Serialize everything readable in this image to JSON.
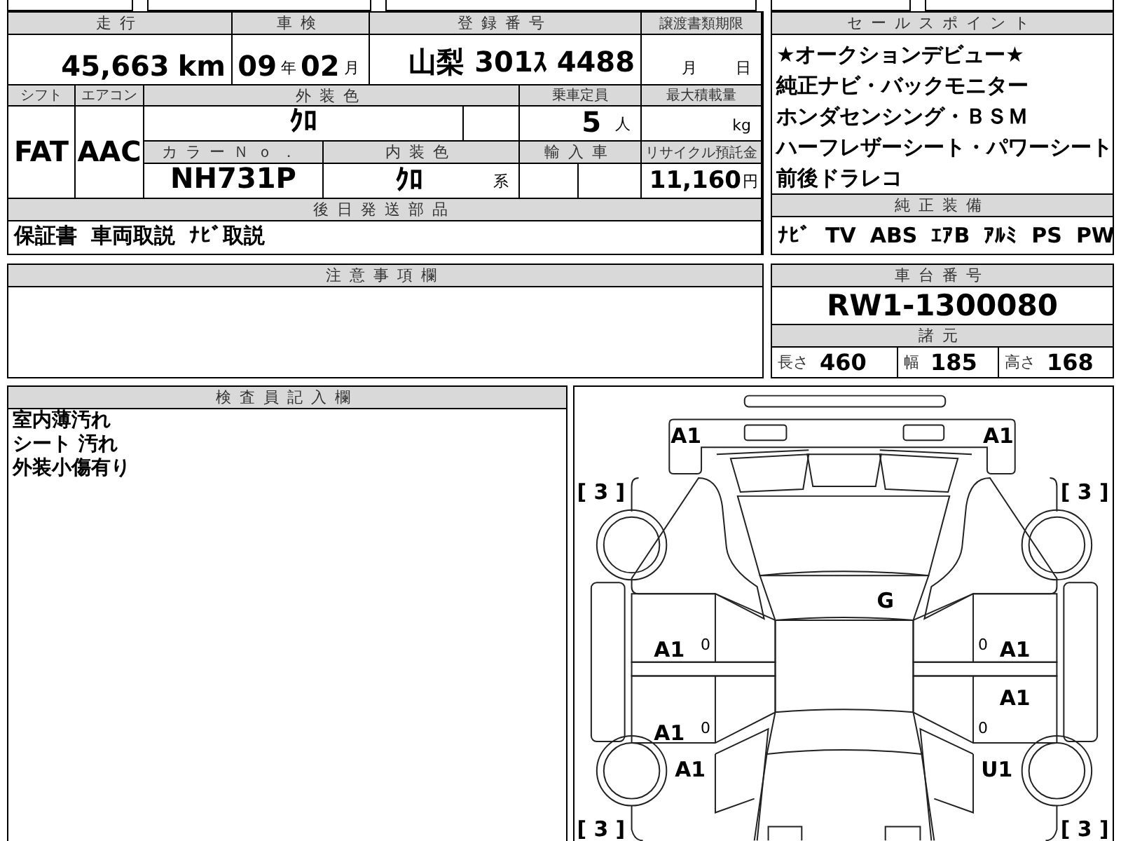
{
  "top_fields": {
    "mileage": {
      "label": "走行",
      "value": "45,663",
      "unit": "km"
    },
    "inspection": {
      "label": "車検",
      "year": "09",
      "year_unit": "年",
      "month": "02",
      "month_unit": "月"
    },
    "registration": {
      "label": "登録番号",
      "value": "山梨 301ｽ 4488"
    },
    "transfer_deadline": {
      "label": "譲渡書類期限",
      "month_unit": "月",
      "day_unit": "日"
    }
  },
  "specs": {
    "shift": {
      "label": "シフト",
      "value": "FAT"
    },
    "aircon": {
      "label": "エアコン",
      "value": "AAC"
    },
    "exterior_color": {
      "label": "外装色",
      "value": "ｸﾛ"
    },
    "capacity": {
      "label": "乗車定員",
      "value": "5",
      "unit": "人"
    },
    "max_load": {
      "label": "最大積載量",
      "unit": "kg"
    },
    "color_no": {
      "label": "カラーＮｏ．",
      "value": "NH731P"
    },
    "interior_color": {
      "label": "内装色",
      "value": "ｸﾛ",
      "unit": "系"
    },
    "import": {
      "label": "輸入車"
    },
    "recycle": {
      "label": "リサイクル預託金",
      "value": "11,160",
      "unit": "円"
    }
  },
  "later_parts": {
    "label": "後日発送部品",
    "items": [
      "保証書",
      "車両取説",
      "ﾅﾋﾞ取説"
    ]
  },
  "sales_points": {
    "label": "セールスポイント",
    "lines": [
      "★オークションデビュー★",
      "純正ナビ・バックモニター",
      "ホンダセンシング・ＢＳＭ",
      "ハーフレザーシート・パワーシート",
      "前後ドラレコ"
    ]
  },
  "equipment": {
    "label": "純正装備",
    "items": [
      "ﾅﾋﾞ",
      "TV",
      "ABS",
      "ｴｱB",
      "ｱﾙﾐ",
      "PS",
      "PW"
    ]
  },
  "notes": {
    "label": "注意事項欄"
  },
  "chassis": {
    "label": "車台番号",
    "value": "RW1-1300080"
  },
  "dimensions": {
    "label": "諸元",
    "items": [
      {
        "label": "長さ",
        "value": "460"
      },
      {
        "label": "幅",
        "value": "185"
      },
      {
        "label": "高さ",
        "value": "168"
      }
    ]
  },
  "inspector": {
    "label": "検査員記入欄",
    "lines": [
      "室内薄汚れ",
      "シート 汚れ",
      "外装小傷有り"
    ]
  },
  "diagram": {
    "marks": [
      "A1",
      "A1",
      "G",
      "A1",
      "A1",
      "A1",
      "A1",
      "A1",
      "U1"
    ],
    "zeros": [
      "0",
      "0",
      "0",
      "0"
    ],
    "ratings": [
      "[ 3 ]",
      "[ 3 ]",
      "[ 3 ]",
      "[ 3 ]"
    ]
  }
}
